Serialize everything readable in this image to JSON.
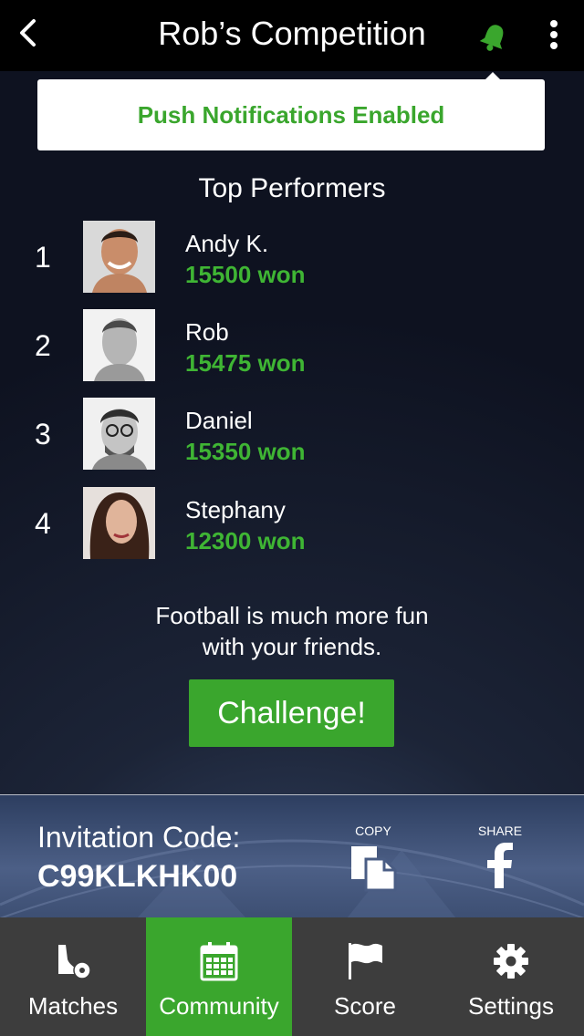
{
  "header": {
    "title": "Rob’s Competition",
    "back_icon": "chevron-left-icon",
    "bell_icon": "bell-icon",
    "more_icon": "more-vertical-icon",
    "accent": "#3aa62d"
  },
  "toast": {
    "message": "Push Notifications Enabled"
  },
  "top_performers": {
    "title": "Top Performers",
    "items": [
      {
        "rank": "1",
        "name": "Andy K.",
        "score": "15500 won"
      },
      {
        "rank": "2",
        "name": "Rob",
        "score": "15475 won"
      },
      {
        "rank": "3",
        "name": "Daniel",
        "score": "15350 won"
      },
      {
        "rank": "4",
        "name": "Stephany",
        "score": "12300 won"
      }
    ]
  },
  "promo": {
    "line1": "Football is much more fun",
    "line2": "with your friends.",
    "challenge_label": "Challenge!"
  },
  "invitation": {
    "label": "Invitation Code:",
    "code": "C99KLKHK00",
    "copy_label": "COPY",
    "share_label": "SHARE",
    "copy_icon": "copy-icon",
    "share_icon": "facebook-icon"
  },
  "tabs": [
    {
      "label": "Matches",
      "icon": "cleat-ball-icon",
      "active": false
    },
    {
      "label": "Community",
      "icon": "calendar-icon",
      "active": true
    },
    {
      "label": "Score",
      "icon": "flag-icon",
      "active": false
    },
    {
      "label": "Settings",
      "icon": "gear-icon",
      "active": false
    }
  ]
}
